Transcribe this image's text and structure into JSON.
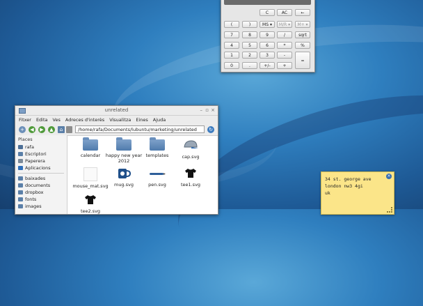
{
  "calculator": {
    "rows": [
      [
        "C",
        "AC",
        "←"
      ],
      [
        "(",
        ")",
        "MS",
        "M/R",
        "M+",
        "⌃"
      ],
      [
        "7",
        "8",
        "9",
        "/",
        "sqrt"
      ],
      [
        "4",
        "5",
        "6",
        "*",
        "%"
      ],
      [
        "1",
        "2",
        "3",
        "-",
        "="
      ],
      [
        "0",
        ".",
        "+/-",
        "+"
      ]
    ],
    "ms_label": "MS ▾",
    "mr_label": "M/R ▾",
    "mplus_label": "M+ ▾",
    "up_label": "⌃"
  },
  "file_manager": {
    "title": "unrelated",
    "menu": [
      "Fitxer",
      "Edita",
      "Ves",
      "Adreces d'interès",
      "Visualitza",
      "Eines",
      "Ajuda"
    ],
    "path": "/home/rafa/Documents/lubuntu/marketing/unrelated",
    "places_header": "Places",
    "places": [
      "rafa",
      "Escriptori",
      "Paperera",
      "Aplicacions"
    ],
    "bookmarks": [
      "baixades",
      "documents",
      "dropbox",
      "fonts",
      "images"
    ],
    "files": [
      {
        "name": "calendar",
        "icon": "folder-icon"
      },
      {
        "name": "happy new year 2012",
        "icon": "folder-icon"
      },
      {
        "name": "templates",
        "icon": "folder-icon"
      },
      {
        "name": "cap.svg",
        "icon": "cap-icon"
      },
      {
        "name": "mouse_mat.svg",
        "icon": "blank-file-icon"
      },
      {
        "name": "mug.svg",
        "icon": "mug-icon"
      },
      {
        "name": "pen.svg",
        "icon": "pen-icon"
      },
      {
        "name": "tee1.svg",
        "icon": "tshirt-icon"
      },
      {
        "name": "tee2.svg",
        "icon": "tshirt-icon"
      }
    ]
  },
  "sticky_note": {
    "lines": [
      "34 st. george ave",
      "london nw3 4gi",
      "uk"
    ]
  }
}
